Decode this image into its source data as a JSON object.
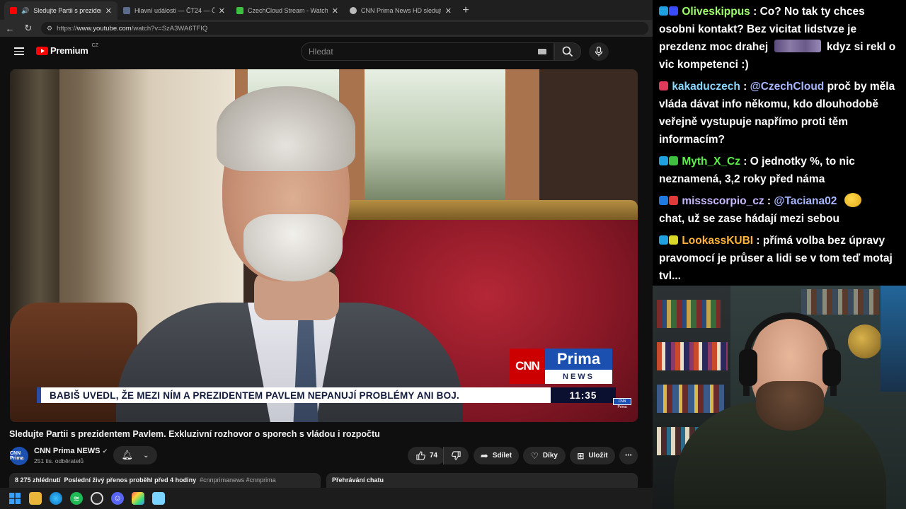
{
  "browser": {
    "tabs": [
      {
        "title": "Sledujte Partii s prezidentem P",
        "active": true,
        "favicon_color": "#ff0000"
      },
      {
        "title": "Hlavní události — ČT24 — Česká t",
        "active": false,
        "favicon_color": "#5a6b8c"
      },
      {
        "title": "CzechCloud Stream - Watch Live o",
        "active": false,
        "favicon_color": "#3fbf3f"
      },
      {
        "title": "CNN Prima News HD sledujte onli",
        "active": false,
        "favicon_color": "#bbbbbb"
      }
    ],
    "url_prefix": "https://",
    "url_host": "www.youtube.com",
    "url_path": "/watch?v=SzA3WA6TFIQ"
  },
  "youtube": {
    "logo_text": "Premium",
    "logo_region": "CZ",
    "search_placeholder": "Hledat"
  },
  "video": {
    "lower_third": "BABIŠ UVEDL, ŽE MEZI NÍM A PREZIDENTEM PAVLEM NEPANUJÍ PROBLÉMY ANI BOJ.",
    "clock": "11:35",
    "logo_cnn": "CNN",
    "logo_prima": "Prima",
    "logo_news": "NEWS",
    "bug_text": "CNN Prima"
  },
  "info": {
    "title": "Sledujte Partii s prezidentem Pavlem. Exkluzivní rozhovor o sporech s vládou i rozpočtu",
    "channel_avatar": "CNN Prima",
    "channel_name": "CNN Prima NEWS",
    "subscribers": "251 tis. odběratelů",
    "like_count": "74",
    "share_label": "Sdílet",
    "thanks_label": "Díky",
    "save_label": "Uložit",
    "more_label": "⋯",
    "views": "8 275 zhlédnutí",
    "stream_info": "Poslední živý přenos proběhl před 4 hodiny",
    "tags": "#cnnprimanews #cnnprima",
    "chat_replay": "Přehrávání chatu"
  },
  "chat": [
    {
      "user": "Oliveskippus",
      "color": "#9dff6a",
      "badges": [
        "#1fa0e0",
        "#3a4bff"
      ],
      "parts": [
        {
          "type": "text",
          "value": "Co? No tak ty chces osobni kontakt? Bez vicitat lidstvze je prezdenz moc drahej"
        },
        {
          "type": "emote"
        },
        {
          "type": "text",
          "value": "kdyz si rekl o vic kompetenci :)"
        }
      ]
    },
    {
      "user": "kakaduczech",
      "color": "#8ad7ff",
      "badges": [
        "#e03a5a"
      ],
      "parts": [
        {
          "type": "mention",
          "value": "@CzechCloud"
        },
        {
          "type": "text",
          "value": "proč by měla vláda dávat info někomu, kdo dlouhodobě veřejně vystupuje napřímo proti těm informacím?"
        }
      ]
    },
    {
      "user": "Myth_X_Cz",
      "color": "#5cf04a",
      "badges": [
        "#1fa0e0",
        "#3fbf3f"
      ],
      "parts": [
        {
          "type": "text",
          "value": "O jednotky %, to nic neznamená, 3,2 roky před náma"
        }
      ]
    },
    {
      "user": "missscorpio_cz",
      "color": "#c8b8ff",
      "badges": [
        "#1f7ae0",
        "#e03a3a"
      ],
      "parts": [
        {
          "type": "mention",
          "value": "@Taciana02"
        },
        {
          "type": "emote2"
        },
        {
          "type": "text",
          "value": "chat, už se zase hádají mezi sebou"
        }
      ]
    },
    {
      "user": "LookassKUBI",
      "color": "#ffb33a",
      "badges": [
        "#1fa0e0",
        "#d8d82a"
      ],
      "parts": [
        {
          "type": "text",
          "value": "přímá volba bez úpravy pravomocí je průser a lidi se v tom teď motaj tvl..."
        }
      ]
    }
  ],
  "taskbar": {
    "icons": [
      "windows-start-icon",
      "file-explorer-icon",
      "edge-icon",
      "spotify-icon",
      "obs-icon",
      "discord-icon",
      "photos-icon",
      "notepad-icon"
    ]
  }
}
